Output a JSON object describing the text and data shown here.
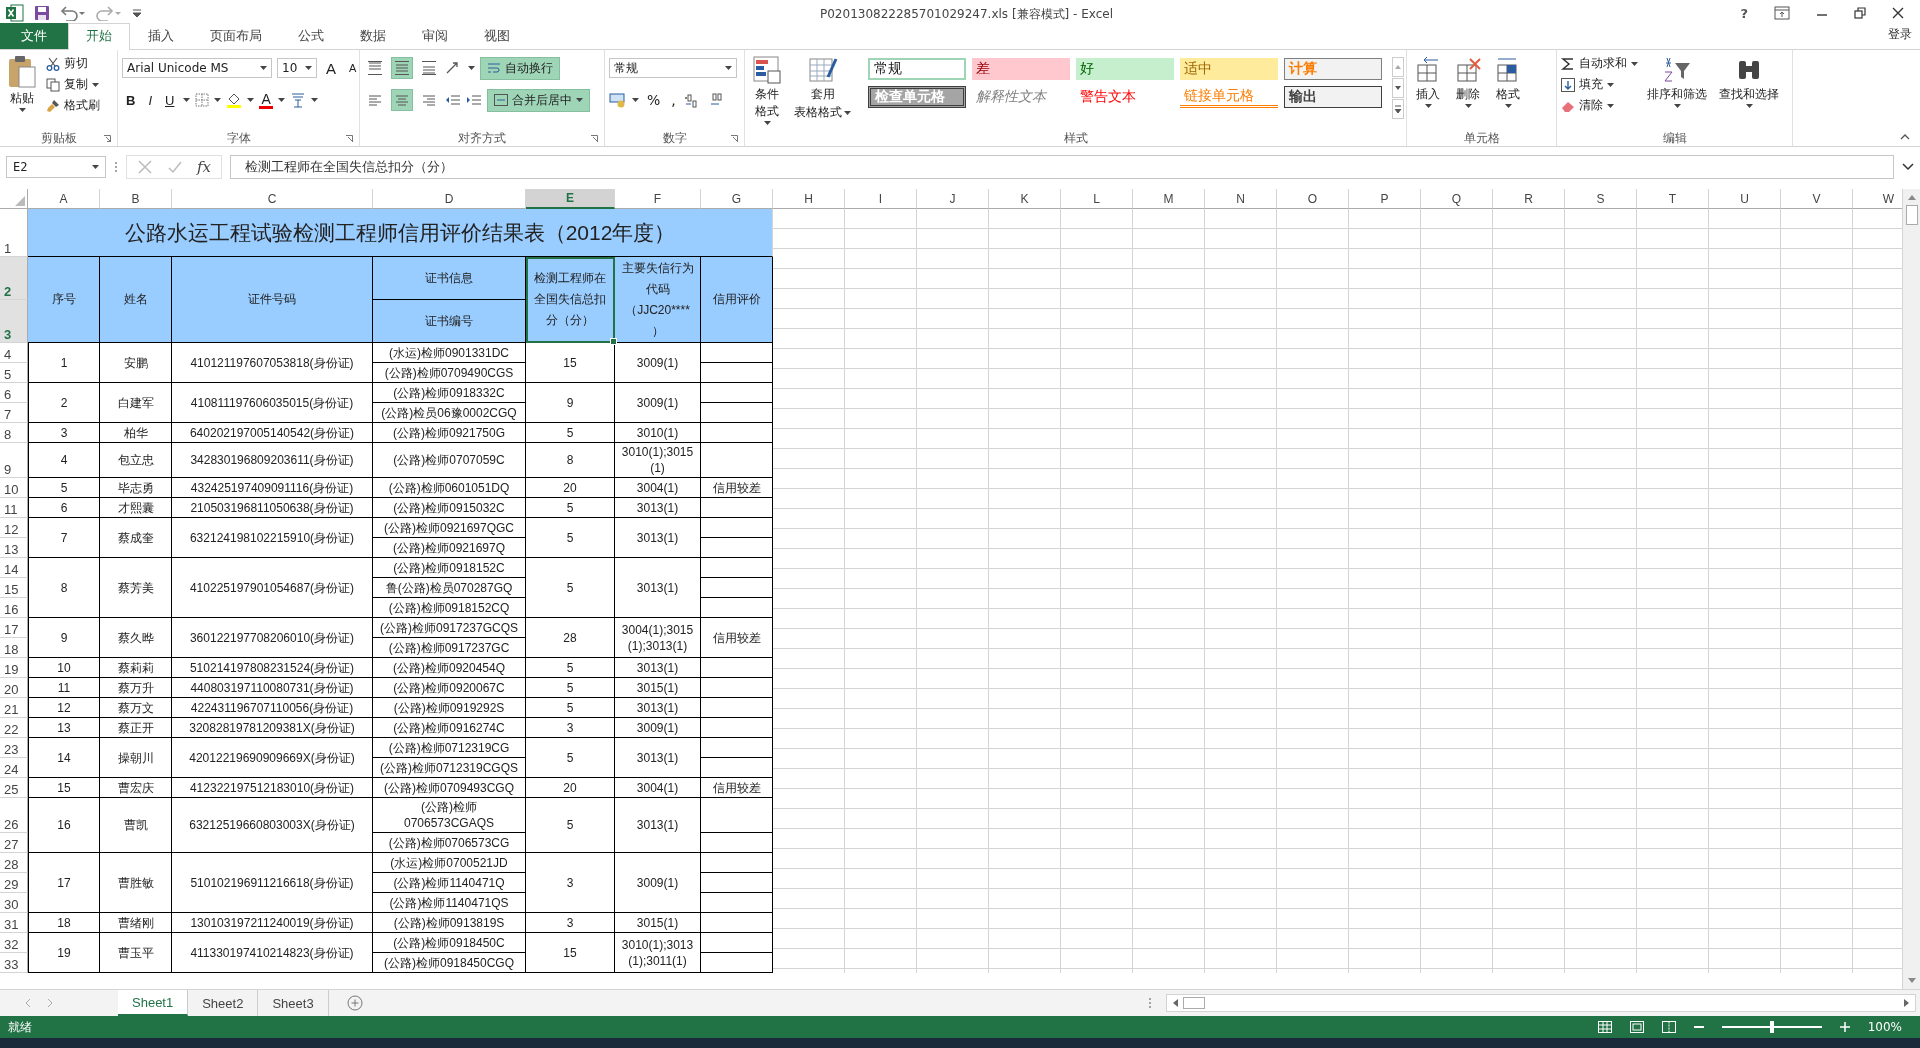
{
  "window": {
    "title": "P020130822285701029247.xls  [兼容模式] - Excel",
    "help": "?"
  },
  "account": "登录",
  "ribbon_tabs": [
    {
      "label": "文件",
      "kind": "file",
      "selected": false
    },
    {
      "label": "开始",
      "kind": "tab",
      "selected": true
    },
    {
      "label": "插入",
      "kind": "tab",
      "selected": false
    },
    {
      "label": "页面布局",
      "kind": "tab",
      "selected": false
    },
    {
      "label": "公式",
      "kind": "tab",
      "selected": false
    },
    {
      "label": "数据",
      "kind": "tab",
      "selected": false
    },
    {
      "label": "审阅",
      "kind": "tab",
      "selected": false
    },
    {
      "label": "视图",
      "kind": "tab",
      "selected": false
    }
  ],
  "clipboard": {
    "paste": "粘贴",
    "cut": "剪切",
    "copy": "复制",
    "format_painter": "格式刷",
    "label": "剪贴板"
  },
  "font": {
    "name": "Arial Unicode MS",
    "size": "10",
    "size_buttons": [
      "A",
      "A"
    ],
    "style_buttons": [
      "B",
      "I",
      "U"
    ],
    "color_glyph": "A",
    "label": "字体"
  },
  "alignment": {
    "vertical_align": [
      {
        "selected": false
      },
      {
        "selected": true
      },
      {
        "selected": false
      }
    ],
    "horizontal_align": [
      {
        "selected": false
      },
      {
        "selected": true
      },
      {
        "selected": false
      }
    ],
    "wrap_text": {
      "label": "自动换行",
      "on": true
    },
    "merge": {
      "label": "合并后居中",
      "on": true
    },
    "label": "对齐方式"
  },
  "number": {
    "format": "常规",
    "symbols": [
      "%",
      ","
    ],
    "label": "数字"
  },
  "styles": {
    "conditional": "条件格式",
    "table_format": [
      "套用",
      "表格格式"
    ],
    "label": "样式",
    "gallery": [
      {
        "label": "常规",
        "kind": "normal"
      },
      {
        "label": "差",
        "kind": "bad"
      },
      {
        "label": "好",
        "kind": "good"
      },
      {
        "label": "适中",
        "kind": "neutral"
      },
      {
        "label": "计算",
        "kind": "calculation"
      },
      {
        "label": "检查单元格",
        "kind": "check"
      },
      {
        "label": "解释性文本",
        "kind": "explanatory"
      },
      {
        "label": "警告文本",
        "kind": "warning"
      },
      {
        "label": "链接单元格",
        "kind": "linked"
      },
      {
        "label": "输出",
        "kind": "output"
      }
    ]
  },
  "cells": {
    "buttons": [
      "插入",
      "删除",
      "格式"
    ],
    "label": "单元格"
  },
  "editing": {
    "autosum": "自动求和",
    "fill": "填充",
    "clear": "清除",
    "sort": "排序和筛选",
    "find": "查找和选择",
    "label": "编辑"
  },
  "formula_bar": {
    "name_box": "E2",
    "function_label": "fx",
    "formula": "检测工程师在全国失信总扣分（分）"
  },
  "sheet": {
    "columns": [
      {
        "letter": "A",
        "selected": false
      },
      {
        "letter": "B",
        "selected": false
      },
      {
        "letter": "C",
        "selected": false
      },
      {
        "letter": "D",
        "selected": false
      },
      {
        "letter": "E",
        "selected": true
      },
      {
        "letter": "F",
        "selected": false
      },
      {
        "letter": "G",
        "selected": false
      },
      {
        "letter": "H",
        "selected": false
      },
      {
        "letter": "I",
        "selected": false
      },
      {
        "letter": "J",
        "selected": false
      },
      {
        "letter": "K",
        "selected": false
      },
      {
        "letter": "L",
        "selected": false
      },
      {
        "letter": "M",
        "selected": false
      },
      {
        "letter": "N",
        "selected": false
      },
      {
        "letter": "O",
        "selected": false
      },
      {
        "letter": "P",
        "selected": false
      },
      {
        "letter": "Q",
        "selected": false
      },
      {
        "letter": "R",
        "selected": false
      },
      {
        "letter": "S",
        "selected": false
      },
      {
        "letter": "T",
        "selected": false
      },
      {
        "letter": "U",
        "selected": false
      },
      {
        "letter": "V",
        "selected": false
      },
      {
        "letter": "W",
        "selected": false
      }
    ],
    "header_rows": [
      {
        "label": "1",
        "selected": false
      },
      {
        "label": "2",
        "selected": true
      },
      {
        "label": "3",
        "selected": true
      }
    ],
    "title": "公路水运工程试验检测工程师信用评价结果表（2012年度）",
    "headers": [
      {
        "text": "序号",
        "selected": false
      },
      {
        "text": "姓名",
        "selected": false
      },
      {
        "text": "证件号码",
        "selected": false
      },
      {
        "text": "证书信息",
        "subtext": "证书编号",
        "selected": false
      },
      {
        "text": "检测工程师在全国失信总扣分（分）",
        "selected": true
      },
      {
        "text": "主要失信行为代码（JJC20****）",
        "selected": false
      },
      {
        "text": "信用评价",
        "selected": false
      }
    ],
    "records": [
      {
        "rows": [
          "4",
          "5"
        ],
        "seq": "1",
        "name": "安鹏",
        "id": "410121197607053818(身份证)",
        "certs": [
          "(水运)检师0901331DC",
          "(公路)检师0709490CGS"
        ],
        "deduction": "15",
        "codes": "3009(1)"
      },
      {
        "rows": [
          "6",
          "7"
        ],
        "seq": "2",
        "name": "白建军",
        "id": "410811197606035015(身份证)",
        "certs": [
          "(公路)检师0918332C",
          "(公路)检员06豫0002CGQ"
        ],
        "deduction": "9",
        "codes": "3009(1)"
      },
      {
        "rows": [
          "8"
        ],
        "seq": "3",
        "name": "柏华",
        "id": "640202197005140542(身份证)",
        "certs": [
          "(公路)检师0921750G"
        ],
        "deduction": "5",
        "codes": "3010(1)"
      },
      {
        "rows": [
          "9"
        ],
        "seq": "4",
        "name": "包立忠",
        "id": "342830196809203611(身份证)",
        "certs": [
          "(公路)检师0707059C"
        ],
        "deduction": "8",
        "codes": "3010(1);3015(1)"
      },
      {
        "rows": [
          "10"
        ],
        "seq": "5",
        "name": "毕志勇",
        "id": "432425197409091116(身份证)",
        "certs": [
          "(公路)检师0601051DQ"
        ],
        "deduction": "20",
        "codes": "3004(1)",
        "rating": "信用较差"
      },
      {
        "rows": [
          "11"
        ],
        "seq": "6",
        "name": "才熙囊",
        "id": "210503196811050638(身份证)",
        "certs": [
          "(公路)检师0915032C"
        ],
        "deduction": "5",
        "codes": "3013(1)"
      },
      {
        "rows": [
          "12",
          "13"
        ],
        "seq": "7",
        "name": "蔡成奎",
        "id": "632124198102215910(身份证)",
        "certs": [
          "(公路)检师0921697QGC",
          "(公路)检师0921697Q"
        ],
        "deduction": "5",
        "codes": "3013(1)"
      },
      {
        "rows": [
          "14",
          "15",
          "16"
        ],
        "seq": "8",
        "name": "蔡芳美",
        "id": "410225197901054687(身份证)",
        "certs": [
          "(公路)检师0918152C",
          "鲁(公路)检员070287GQ",
          "(公路)检师0918152CQ"
        ],
        "deduction": "5",
        "codes": "3013(1)"
      },
      {
        "rows": [
          "17",
          "18"
        ],
        "seq": "9",
        "name": "蔡久晔",
        "id": "360122197708206010(身份证)",
        "certs": [
          "(公路)检师0917237GCQS",
          "(公路)检师0917237GC"
        ],
        "deduction": "28",
        "codes": "3004(1);3015(1);3013(1)",
        "rating": "信用较差"
      },
      {
        "rows": [
          "19"
        ],
        "seq": "10",
        "name": "蔡莉莉",
        "id": "510214197808231524(身份证)",
        "certs": [
          "(公路)检师0920454Q"
        ],
        "deduction": "5",
        "codes": "3013(1)"
      },
      {
        "rows": [
          "20"
        ],
        "seq": "11",
        "name": "蔡万升",
        "id": "440803197110080731(身份证)",
        "certs": [
          "(公路)检师0920067C"
        ],
        "deduction": "5",
        "codes": "3015(1)"
      },
      {
        "rows": [
          "21"
        ],
        "seq": "12",
        "name": "蔡万文",
        "id": "422431196707110056(身份证)",
        "certs": [
          "(公路)检师0919292S"
        ],
        "deduction": "5",
        "codes": "3013(1)"
      },
      {
        "rows": [
          "22"
        ],
        "seq": "13",
        "name": "蔡正开",
        "id": "32082819781209381X(身份证)",
        "certs": [
          "(公路)检师0916274C"
        ],
        "deduction": "3",
        "codes": "3009(1)"
      },
      {
        "rows": [
          "23",
          "24"
        ],
        "seq": "14",
        "name": "操朝川",
        "id": "42012219690909669X(身份证)",
        "certs": [
          "(公路)检师0712319CG",
          "(公路)检师0712319CGQS"
        ],
        "deduction": "5",
        "codes": "3013(1)"
      },
      {
        "rows": [
          "25"
        ],
        "seq": "15",
        "name": "曹宏庆",
        "id": "412322197512183010(身份证)",
        "certs": [
          "(公路)检师0709493CGQ"
        ],
        "deduction": "20",
        "codes": "3004(1)",
        "rating": "信用较差"
      },
      {
        "rows": [
          "26",
          "27"
        ],
        "seq": "16",
        "name": "曹凯",
        "id": "63212519660803003X(身份证)",
        "certs": [
          "(公路)检师0706573CGAQS",
          "(公路)检师0706573CG"
        ],
        "deduction": "5",
        "codes": "3013(1)"
      },
      {
        "rows": [
          "28",
          "29",
          "30"
        ],
        "seq": "17",
        "name": "曹胜敏",
        "id": "510102196911216618(身份证)",
        "certs": [
          "(水运)检师0700521JD",
          "(公路)检师1140471Q",
          "(公路)检师1140471QS"
        ],
        "deduction": "3",
        "codes": "3009(1)"
      },
      {
        "rows": [
          "31"
        ],
        "seq": "18",
        "name": "曹绪刚",
        "id": "130103197211240019(身份证)",
        "certs": [
          "(公路)检师0913819S"
        ],
        "deduction": "3",
        "codes": "3015(1)"
      },
      {
        "rows": [
          "32",
          "33"
        ],
        "seq": "19",
        "name": "曹玉平",
        "id": "411330197410214823(身份证)",
        "certs": [
          "(公路)检师0918450C",
          "(公路)检师0918450CGQ"
        ],
        "deduction": "15",
        "codes": "3010(1);3013(1);3011(1)"
      }
    ]
  },
  "sheet_tabs": [
    {
      "label": "Sheet1",
      "selected": true
    },
    {
      "label": "Sheet2",
      "selected": false
    },
    {
      "label": "Sheet3",
      "selected": false
    }
  ],
  "status_bar": {
    "status": "就绪",
    "zoom": {
      "level": 0.5,
      "reading": "100%"
    }
  }
}
